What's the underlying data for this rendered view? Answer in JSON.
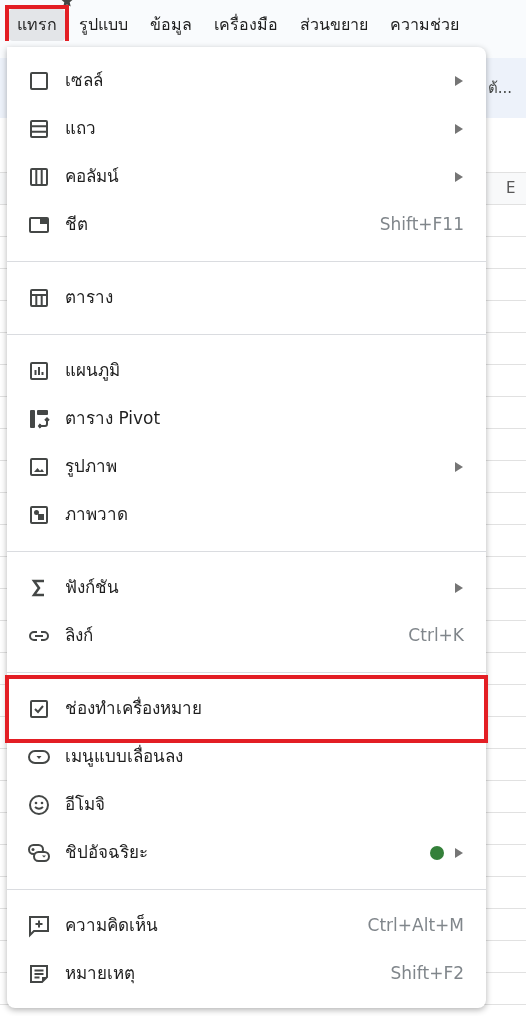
{
  "menu_bar": [
    {
      "label": "แทรก",
      "selected": true,
      "highlighted": true
    },
    {
      "label": "รูปแบบ",
      "selected": false,
      "highlighted": false
    },
    {
      "label": "ข้อมูล",
      "selected": false,
      "highlighted": false
    },
    {
      "label": "เครื่องมือ",
      "selected": false,
      "highlighted": false
    },
    {
      "label": "ส่วนขยาย",
      "selected": false,
      "highlighted": false
    },
    {
      "label": "ความช่วย",
      "selected": false,
      "highlighted": false
    }
  ],
  "banner": {
    "text": "ต้..."
  },
  "column_header": {
    "label": "E"
  },
  "insert_menu": {
    "sections": [
      {
        "items": [
          {
            "label": "เซลล์",
            "submenu": true,
            "highlighted": false
          },
          {
            "label": "แถว",
            "submenu": true,
            "highlighted": false
          },
          {
            "label": "คอลัมน์",
            "submenu": true,
            "highlighted": false
          },
          {
            "label": "ชีต",
            "shortcut": "Shift+F11",
            "submenu": false,
            "highlighted": false
          }
        ]
      },
      {
        "items": [
          {
            "label": "ตาราง",
            "submenu": false,
            "highlighted": false
          }
        ]
      },
      {
        "items": [
          {
            "label": "แผนภูมิ",
            "submenu": false,
            "highlighted": false
          },
          {
            "label": "ตาราง Pivot",
            "submenu": false,
            "highlighted": false
          },
          {
            "label": "รูปภาพ",
            "submenu": true,
            "highlighted": false
          },
          {
            "label": "ภาพวาด",
            "submenu": false,
            "highlighted": false
          }
        ]
      },
      {
        "items": [
          {
            "label": "ฟังก์ชัน",
            "submenu": true,
            "highlighted": false
          },
          {
            "label": "ลิงก์",
            "shortcut": "Ctrl+K",
            "submenu": false,
            "highlighted": false
          }
        ]
      },
      {
        "items": [
          {
            "label": "ช่องทำเครื่องหมาย",
            "submenu": false,
            "highlighted": true
          },
          {
            "label": "เมนูแบบเลื่อนลง",
            "submenu": false,
            "highlighted": false
          },
          {
            "label": "อีโมจิ",
            "submenu": false,
            "highlighted": false
          },
          {
            "label": "ชิปอัจฉริยะ",
            "submenu": true,
            "highlighted": false,
            "color": "#34803a"
          }
        ]
      },
      {
        "items": [
          {
            "label": "ความคิดเห็น",
            "shortcut": "Ctrl+Alt+M",
            "submenu": false,
            "highlighted": false
          },
          {
            "label": "หมายเหตุ",
            "shortcut": "Shift+F2",
            "submenu": false,
            "highlighted": false
          }
        ]
      }
    ]
  }
}
